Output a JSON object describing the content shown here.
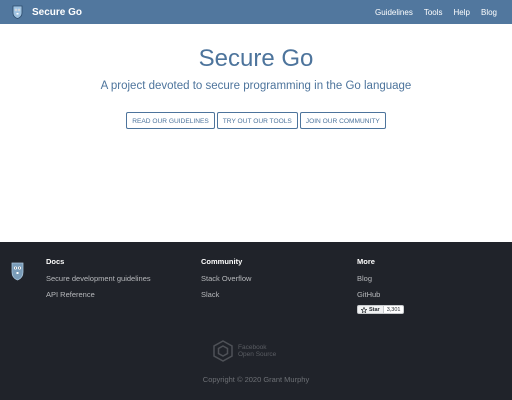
{
  "nav": {
    "brand": "Secure Go",
    "logo_icon": "gopher-shield-icon",
    "links": [
      "Guidelines",
      "Tools",
      "Help",
      "Blog"
    ]
  },
  "hero": {
    "title": "Secure Go",
    "subtitle": "A project devoted to secure programming in the Go language",
    "buttons": [
      "Read our guidelines",
      "Try out our tools",
      "Join our community"
    ]
  },
  "footer": {
    "logo_icon": "gopher-shield-icon",
    "docs": {
      "title": "Docs",
      "links": [
        "Secure development guidelines",
        "API Reference"
      ]
    },
    "community": {
      "title": "Community",
      "links": [
        "Stack Overflow",
        "Slack"
      ]
    },
    "more": {
      "title": "More",
      "links": [
        "Blog",
        "GitHub"
      ],
      "star_label": "Star",
      "star_count": "3,301",
      "star_icon": "github-octocat-icon"
    },
    "oss_logo_text_1": "Facebook",
    "oss_logo_text_2": "Open Source",
    "oss_logo_icon": "facebook-open-source-icon",
    "copyright": "Copyright © 2020 Grant Murphy"
  },
  "colors": {
    "navbar": "#51779e",
    "accent": "#4d749c",
    "footer_bg": "#20232a"
  }
}
